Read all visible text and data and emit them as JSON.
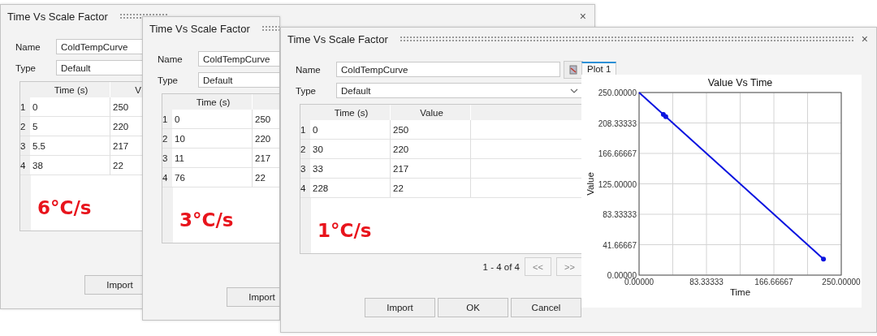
{
  "dialogs": [
    {
      "title": "Time Vs Scale Factor",
      "close_glyph": "×",
      "fields": [
        {
          "label": "Name",
          "value": "ColdTempCurve",
          "kind": "text"
        },
        {
          "label": "Type",
          "value": "Default",
          "kind": "text"
        }
      ],
      "table": {
        "columns": [
          "Time (s)",
          "V"
        ],
        "rows": [
          {
            "index": "1",
            "cells": [
              "0",
              "250"
            ]
          },
          {
            "index": "2",
            "cells": [
              "5",
              "220"
            ]
          },
          {
            "index": "3",
            "cells": [
              "5.5",
              "217"
            ]
          },
          {
            "index": "4",
            "cells": [
              "38",
              "22"
            ]
          }
        ]
      },
      "note": "6°C/s",
      "buttons": [
        "Import"
      ]
    },
    {
      "title": "Time Vs Scale Factor",
      "fields": [
        {
          "label": "Name",
          "value": "ColdTempCurve",
          "kind": "text"
        },
        {
          "label": "Type",
          "value": "Default",
          "kind": "text"
        }
      ],
      "table": {
        "columns": [
          "Time (s)"
        ],
        "rows": [
          {
            "index": "1",
            "cells": [
              "0",
              "250"
            ]
          },
          {
            "index": "2",
            "cells": [
              "10",
              "220"
            ]
          },
          {
            "index": "3",
            "cells": [
              "11",
              "217"
            ]
          },
          {
            "index": "4",
            "cells": [
              "76",
              "22"
            ]
          }
        ]
      },
      "note": "3°C/s",
      "buttons": [
        "Import"
      ]
    },
    {
      "title": "Time Vs Scale Factor",
      "close_glyph": "×",
      "fields": [
        {
          "label": "Name",
          "value": "ColdTempCurve",
          "kind": "picker"
        },
        {
          "label": "Type",
          "value": "Default",
          "kind": "dropdown"
        }
      ],
      "table": {
        "columns": [
          "Time (s)",
          "Value"
        ],
        "rows": [
          {
            "index": "1",
            "cells": [
              "0",
              "250"
            ]
          },
          {
            "index": "2",
            "cells": [
              "30",
              "220"
            ]
          },
          {
            "index": "3",
            "cells": [
              "33",
              "217"
            ]
          },
          {
            "index": "4",
            "cells": [
              "228",
              "22"
            ]
          }
        ]
      },
      "note": "1°C/s",
      "pager": {
        "text": "1 - 4 of 4",
        "buttons": [
          "<<",
          ">>"
        ]
      },
      "buttons": [
        "Import",
        "OK",
        "Cancel"
      ],
      "plot": {
        "tabs": [
          {
            "label": "Plot 1",
            "selected": true
          }
        ],
        "chart_data": {
          "type": "line",
          "title": "Value Vs Time",
          "xlabel": "Time",
          "ylabel": "Value",
          "x": [
            0,
            30,
            33,
            228
          ],
          "series": [
            {
              "color": "#0a14e0",
              "values": [
                250,
                220,
                217,
                22
              ]
            }
          ],
          "grid": true,
          "xlim": [
            0,
            250
          ],
          "ylim": [
            0,
            250
          ],
          "xticks": [
            {
              "value": 0,
              "label": "0.00000"
            },
            {
              "value": 83.33333,
              "label": "83.33333"
            },
            {
              "value": 166.66667,
              "label": "166.66667"
            },
            {
              "value": 250,
              "label": "250.00000"
            }
          ],
          "yticks": [
            {
              "value": 0,
              "label": "0.00000"
            },
            {
              "value": 41.66667,
              "label": "41.66667"
            },
            {
              "value": 83.33333,
              "label": "83.33333"
            },
            {
              "value": 125,
              "label": "125.00000"
            },
            {
              "value": 166.66667,
              "label": "166.66667"
            },
            {
              "value": 208.33333,
              "label": "208.33333"
            },
            {
              "value": 250,
              "label": "250.00000"
            }
          ]
        }
      }
    }
  ]
}
